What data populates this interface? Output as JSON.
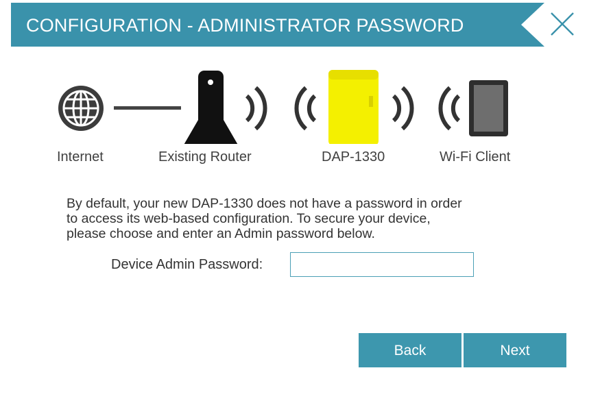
{
  "header": {
    "title": "CONFIGURATION - ADMINISTRATOR PASSWORD",
    "close_icon": "close-x-icon",
    "banner_color": "#3a92ab"
  },
  "diagram": {
    "labels": {
      "internet": "Internet",
      "router": "Existing Router",
      "extender": "DAP-1330",
      "client": "Wi-Fi Client"
    },
    "extender_color": "#f4f000",
    "icons": [
      "globe-icon",
      "router-icon",
      "wifi-signal-icon",
      "extender-icon",
      "tablet-icon"
    ]
  },
  "content": {
    "description_lines": [
      "By default, your new DAP-1330 does not have a password in order",
      "to access its web-based configuration. To secure your device,",
      "please choose and enter an Admin password below."
    ],
    "password_label": "Device Admin Password:",
    "password_value": ""
  },
  "buttons": {
    "back": "Back",
    "next": "Next",
    "color": "#3d97ae"
  }
}
